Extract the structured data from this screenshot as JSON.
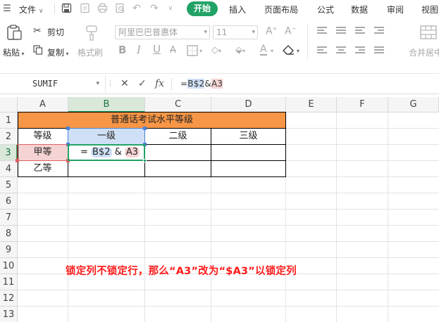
{
  "menubar": {
    "file_label": "文件",
    "tabs": [
      "开始",
      "插入",
      "页面布局",
      "公式",
      "数据",
      "审阅",
      "视图"
    ]
  },
  "ribbon": {
    "paste_label": "粘贴",
    "cut_label": "剪切",
    "copy_label": "复制",
    "format_painter_label": "格式刷",
    "font_name": "阿里巴巴普惠体",
    "font_size": "11",
    "merge_center_label": "合并居中"
  },
  "formula_bar": {
    "name_box": "SUMIF",
    "formula_prefix": "=",
    "formula_ref1": "B$2",
    "formula_op": "&",
    "formula_ref2": "A3"
  },
  "sheet": {
    "columns": [
      "A",
      "B",
      "C",
      "D",
      "E",
      "F",
      "G"
    ],
    "rows": [
      "1",
      "2",
      "3",
      "4",
      "5",
      "6",
      "7",
      "8",
      "9",
      "10",
      "11",
      "12",
      "13"
    ],
    "active_column": "B",
    "active_row": "3",
    "title": "普通话考试水平等级",
    "headers": [
      "等级",
      "一级",
      "二级",
      "三级"
    ],
    "row3_label": "甲等",
    "row4_label": "乙等",
    "edit_cell": {
      "prefix": "= ",
      "ref1": "B$2",
      "op": " & ",
      "ref2": "A3"
    },
    "header_fill_color": "#f79646",
    "ref1_color": "#cfe0f6",
    "ref2_color": "#f6d3d3"
  },
  "annotation": "锁定列不锁定行，那么“A3”改为“$A3”以锁定列"
}
